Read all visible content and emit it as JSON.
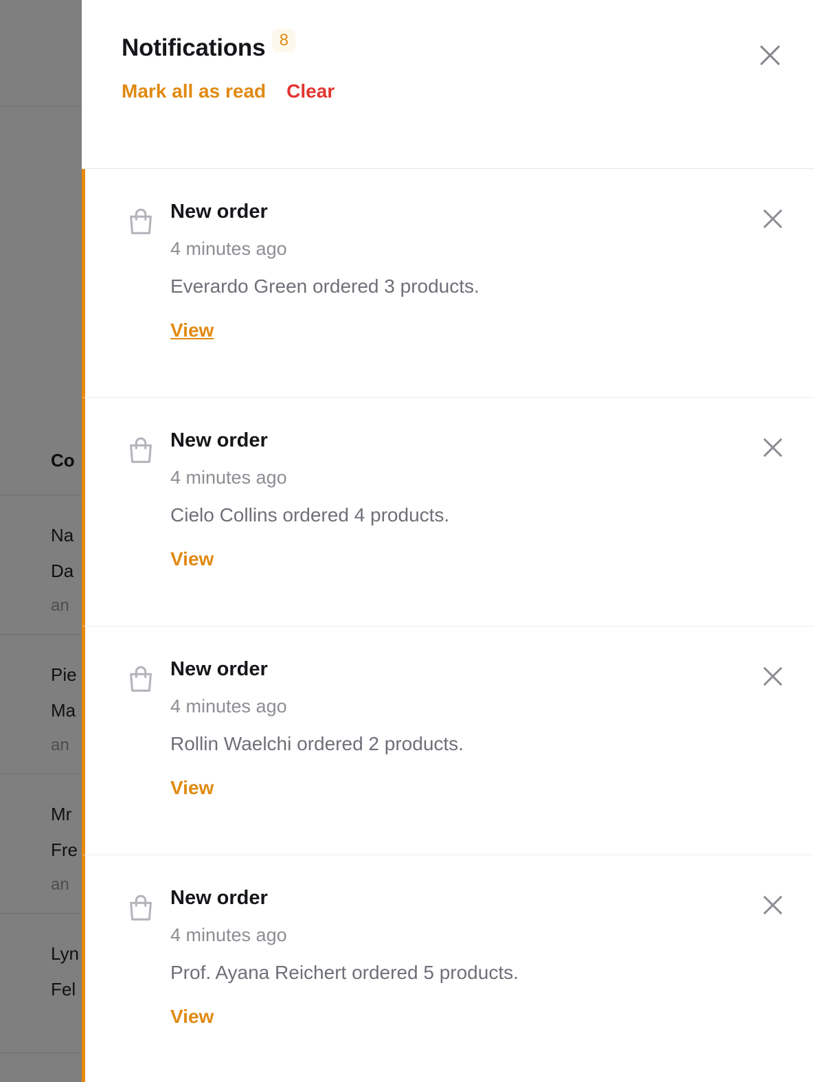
{
  "background": {
    "column_header": "Co",
    "rows": [
      {
        "line1": "Na",
        "line2": "Da",
        "line3": "an"
      },
      {
        "line1": "Pie",
        "line2": "Ma",
        "line3": "an"
      },
      {
        "line1": "Mr",
        "line2": "Fre",
        "line3": "an"
      },
      {
        "line1": "Lyn",
        "line2": "Fel",
        "line3": ""
      }
    ]
  },
  "drawer": {
    "title": "Notifications",
    "badge_count": "8",
    "close_icon": "close-icon",
    "actions": {
      "mark_all_as_read": "Mark all as read",
      "clear": "Clear"
    },
    "colors": {
      "accent_orange": "#e08a12",
      "border_orange": "#e8890c",
      "clear_red": "#e3342f",
      "badge_bg": "#fdf8ec",
      "title_text": "#16161a",
      "muted_text": "#8d8d94",
      "body_text": "#6f6f78",
      "divider": "#ececec",
      "overlay_gray": "#828282"
    },
    "notifications": [
      {
        "icon": "shopping-bag-icon",
        "title": "New order",
        "time": "4 minutes ago",
        "message": "Everardo Green ordered 3 products.",
        "view_label": "View",
        "view_hovered": true,
        "dismiss_icon": "close-icon"
      },
      {
        "icon": "shopping-bag-icon",
        "title": "New order",
        "time": "4 minutes ago",
        "message": "Cielo Collins ordered 4 products.",
        "view_label": "View",
        "view_hovered": false,
        "dismiss_icon": "close-icon"
      },
      {
        "icon": "shopping-bag-icon",
        "title": "New order",
        "time": "4 minutes ago",
        "message": "Rollin Waelchi ordered 2 products.",
        "view_label": "View",
        "view_hovered": false,
        "dismiss_icon": "close-icon"
      },
      {
        "icon": "shopping-bag-icon",
        "title": "New order",
        "time": "4 minutes ago",
        "message": "Prof. Ayana Reichert ordered 5 products.",
        "view_label": "View",
        "view_hovered": false,
        "dismiss_icon": "close-icon"
      }
    ]
  }
}
